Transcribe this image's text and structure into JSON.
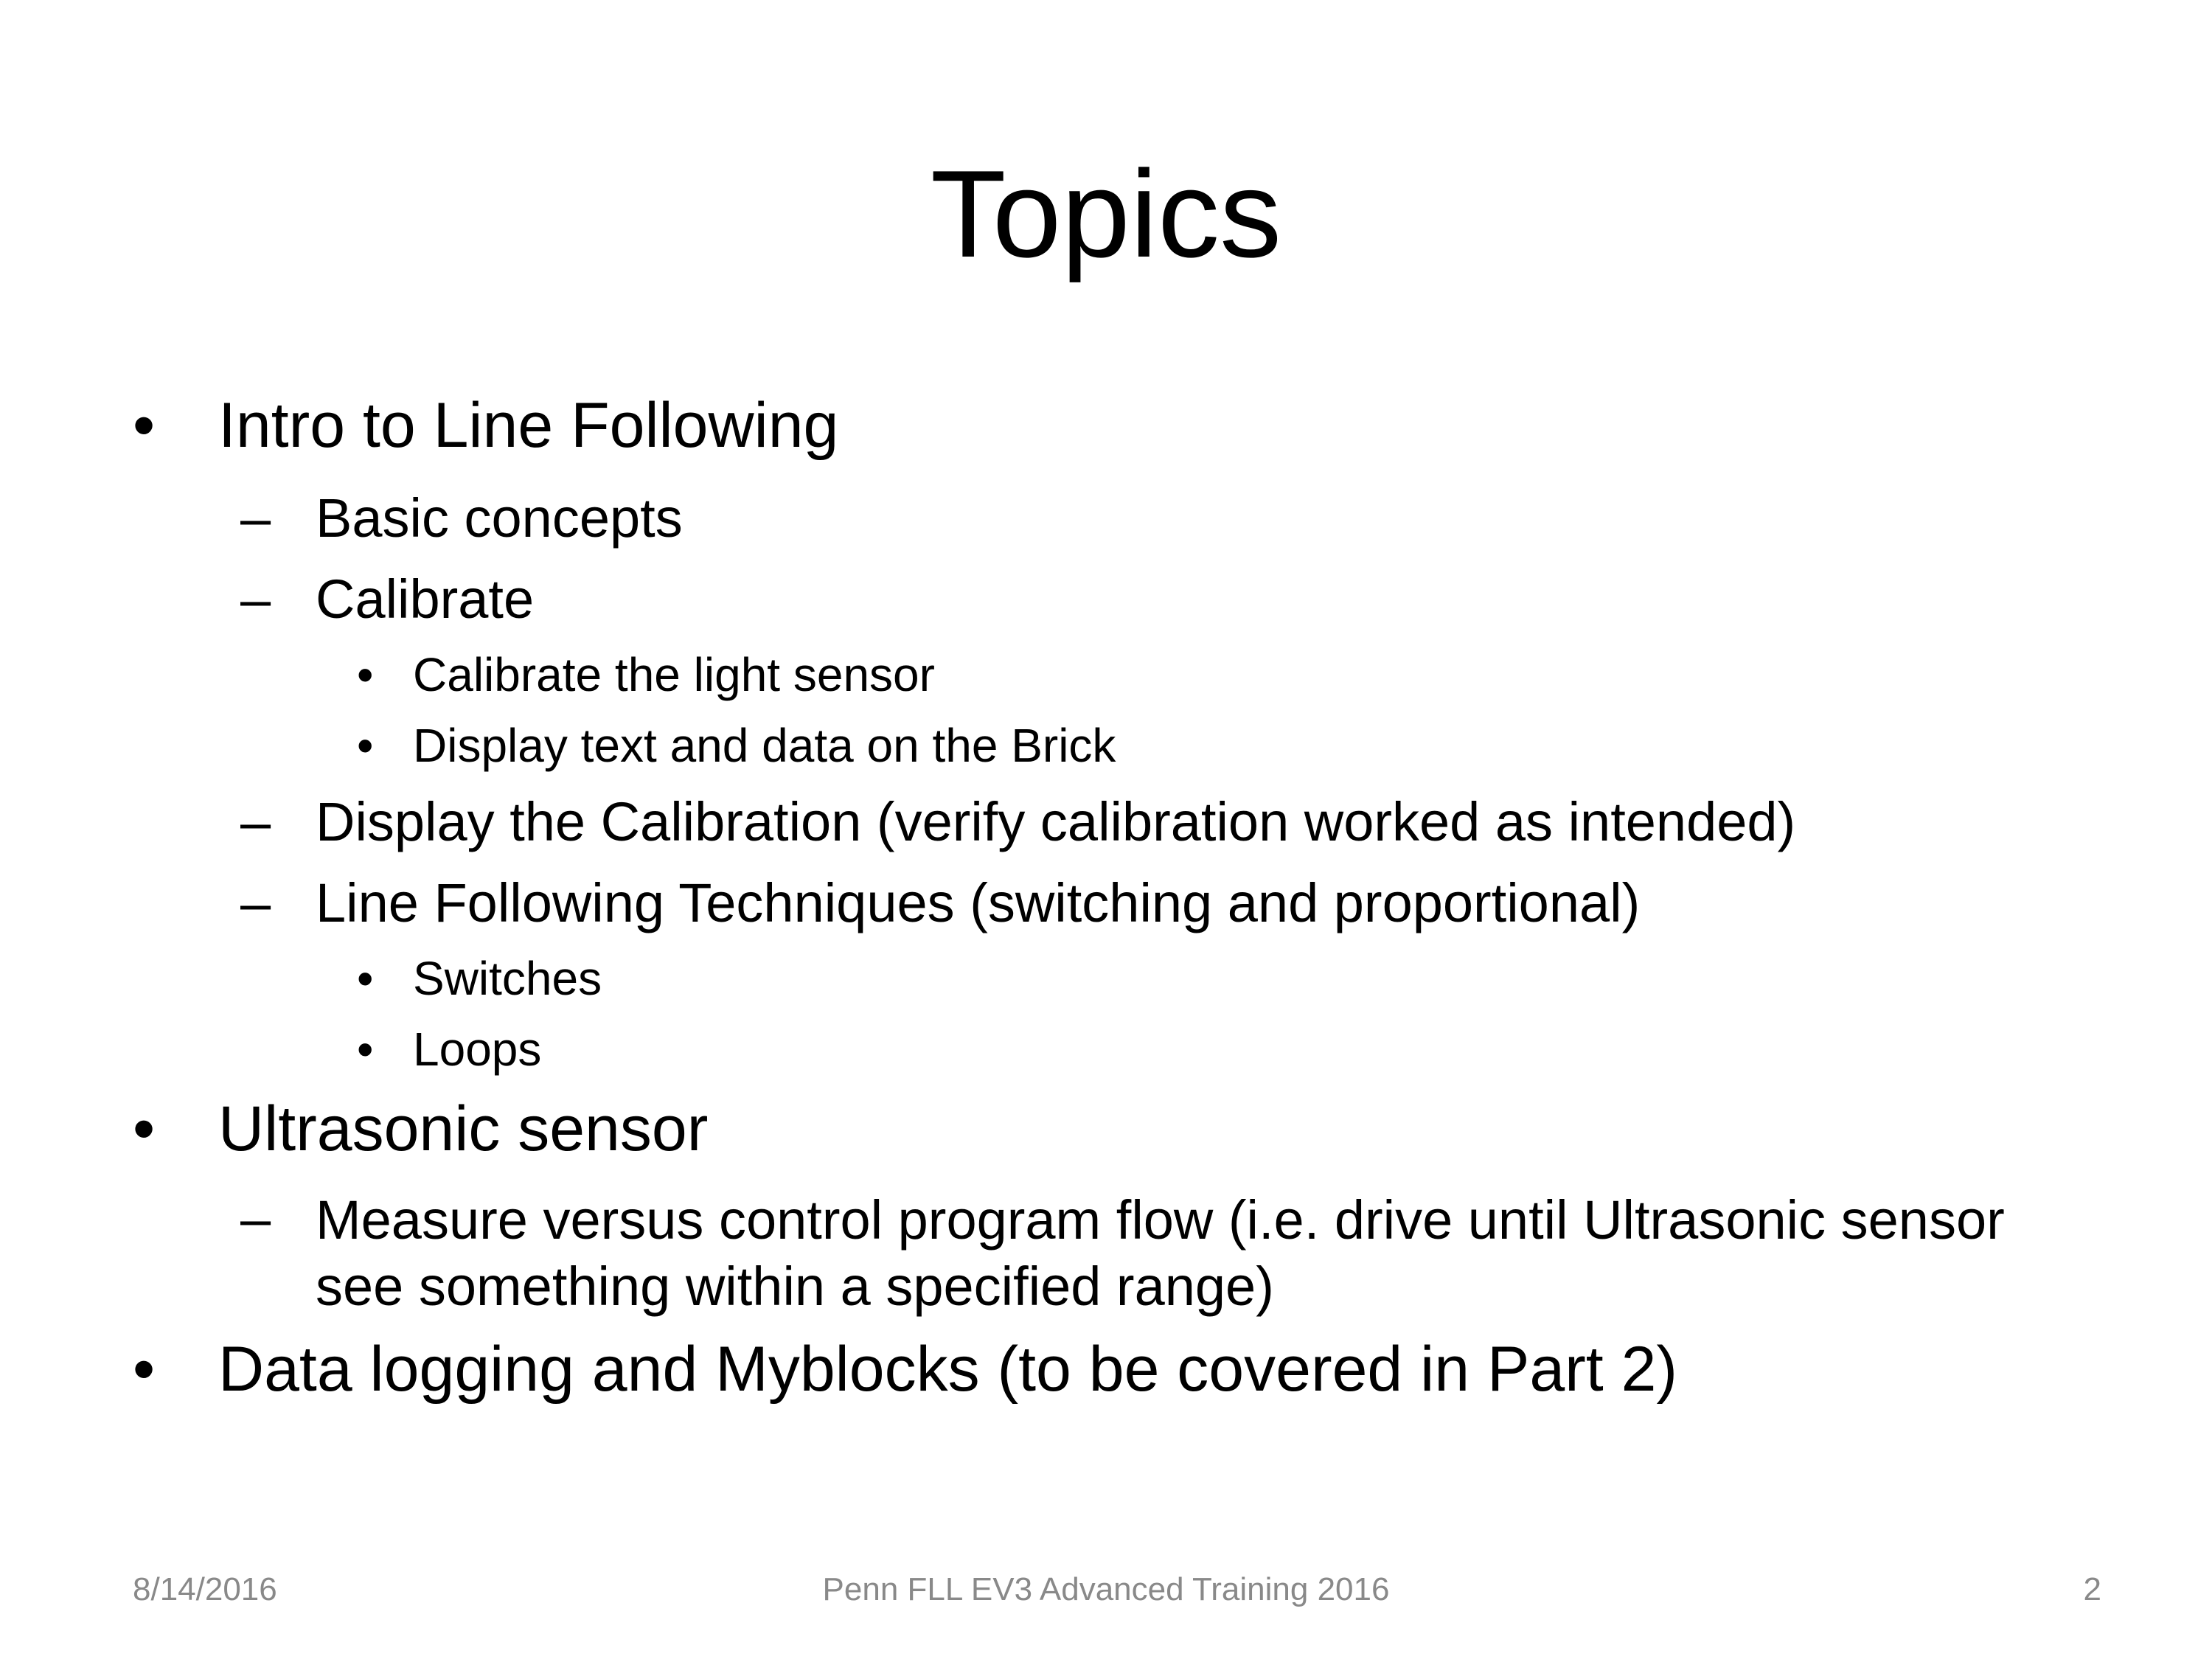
{
  "slide": {
    "title": "Topics",
    "bullets": [
      {
        "marker": "•",
        "text": "Intro to Line Following"
      },
      {
        "marker": "–",
        "text": "Basic concepts"
      },
      {
        "marker": "–",
        "text": "Calibrate"
      },
      {
        "marker": "•",
        "text": "Calibrate the light sensor"
      },
      {
        "marker": "•",
        "text": "Display text and data on the Brick"
      },
      {
        "marker": "–",
        "text": "Display the Calibration (verify calibration worked as intended)"
      },
      {
        "marker": "–",
        "text": "Line Following Techniques (switching and proportional)"
      },
      {
        "marker": "•",
        "text": "Switches"
      },
      {
        "marker": "•",
        "text": "Loops"
      },
      {
        "marker": "•",
        "text": "Ultrasonic sensor"
      },
      {
        "marker": "–",
        "text": "Measure versus control program flow (i.e. drive until Ultrasonic sensor see something within a specified range)"
      },
      {
        "marker": "•",
        "text": "Data logging and Myblocks (to be covered in Part 2)"
      }
    ]
  },
  "footer": {
    "date": "8/14/2016",
    "center": "Penn FLL EV3 Advanced Training 2016",
    "page_number": "2"
  }
}
